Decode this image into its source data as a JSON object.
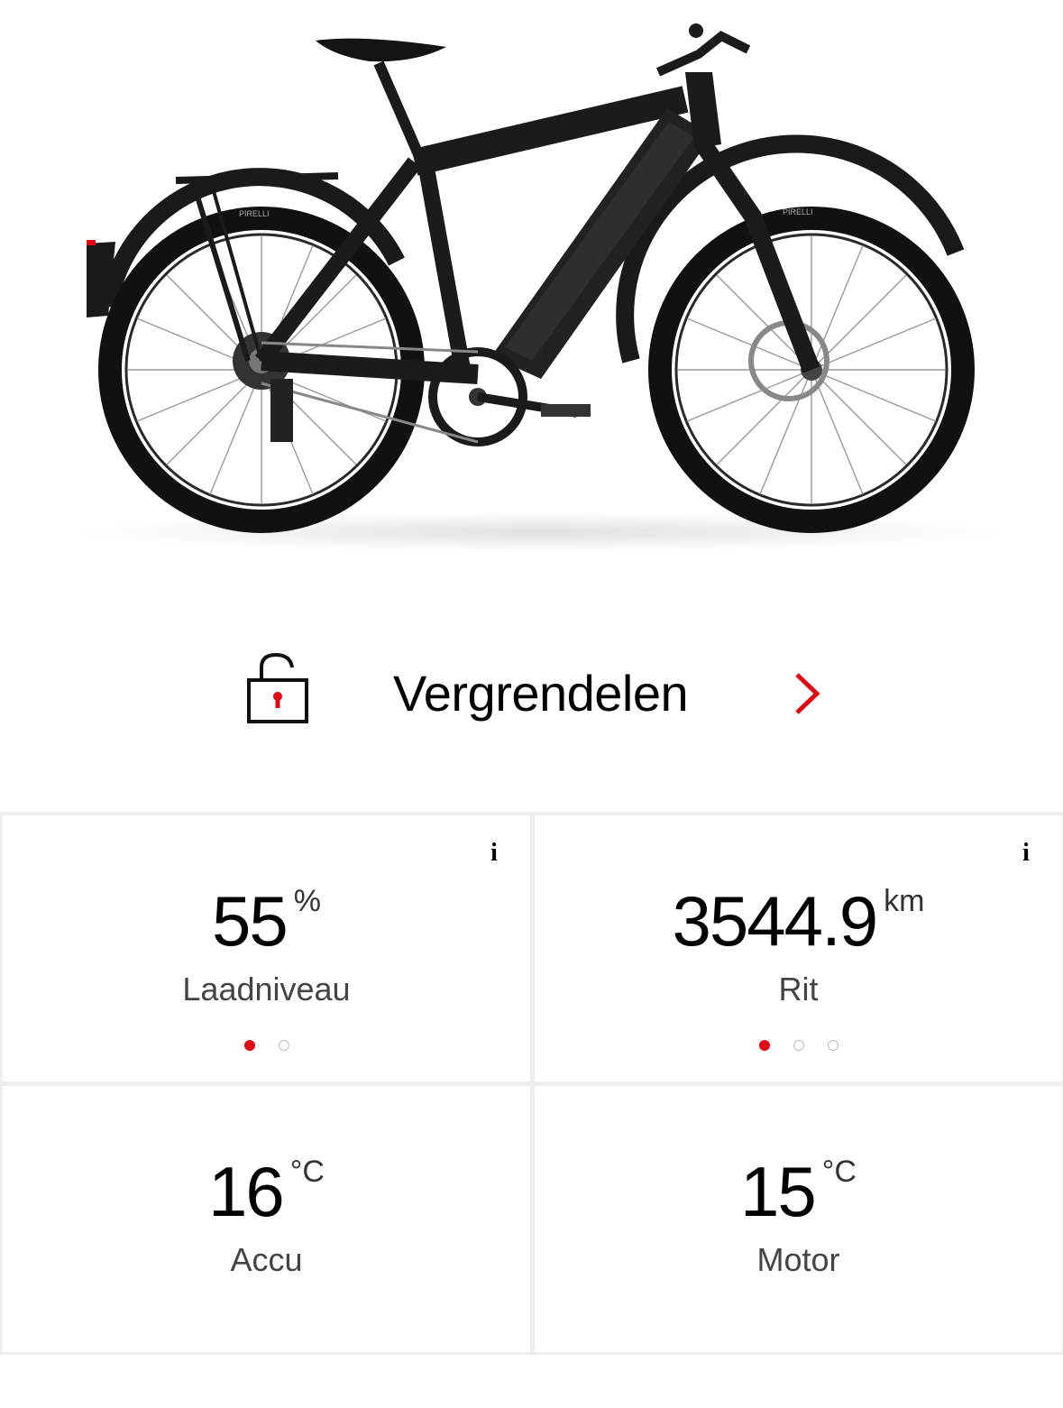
{
  "colors": {
    "accent": "#e30613",
    "text": "#000000",
    "caption": "#444444",
    "tile_bg": "#ffffff",
    "divider": "#eeeeee"
  },
  "hero": {
    "image": "bike-illustration",
    "tire_text": "PIRELLI"
  },
  "lock": {
    "label": "Vergrendelen",
    "icon": "padlock-open-icon",
    "chevron_icon": "chevron-right-icon"
  },
  "tiles": [
    {
      "value": "55",
      "unit": "%",
      "label": "Laadniveau",
      "info": "i",
      "dots_total": 2,
      "dots_active": 1
    },
    {
      "value": "3544.9",
      "unit": "km",
      "label": "Rit",
      "info": "i",
      "dots_total": 3,
      "dots_active": 1
    },
    {
      "value": "16",
      "unit": "°C",
      "label": "Accu"
    },
    {
      "value": "15",
      "unit": "°C",
      "label": "Motor"
    }
  ]
}
